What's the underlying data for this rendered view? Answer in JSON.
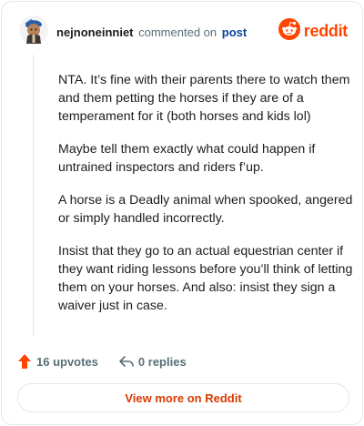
{
  "header": {
    "username": "nejnoneinniet",
    "commented_text": "commented on",
    "post_link": "post",
    "logo_text": "reddit"
  },
  "comment": {
    "paragraphs": [
      "NTA. It’s fine with their parents there to watch them and them petting the horses if they are of a temperament for it (both horses and kids lol)",
      "Maybe tell them exactly what could happen if untrained inspectors and riders f’up.",
      "A horse is a Deadly animal when spooked, angered or simply handled incorrectly.",
      "Insist that they go to an actual equestrian center if they want riding lessons before you’ll think of letting them on your horses. And also: insist they sign a waiver just in case."
    ]
  },
  "actions": {
    "upvotes": "16 upvotes",
    "replies": "0 replies"
  },
  "footer": {
    "view_more": "View more on Reddit"
  },
  "colors": {
    "brand": "#ff4500",
    "link": "#0a449b",
    "muted": "#576f76",
    "view_more": "#d93a00"
  }
}
